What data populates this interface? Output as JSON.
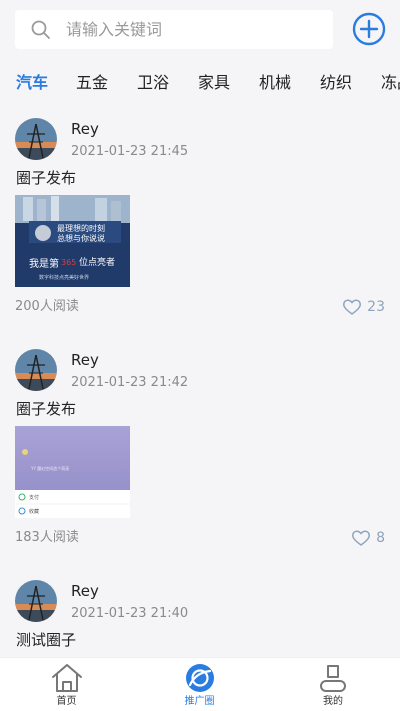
{
  "search": {
    "placeholder": "请输入关键词",
    "icon": "search-icon"
  },
  "header": {
    "add_icon": "plus-circle-icon"
  },
  "tabs": [
    {
      "label": "汽车",
      "active": true
    },
    {
      "label": "五金"
    },
    {
      "label": "卫浴"
    },
    {
      "label": "家具"
    },
    {
      "label": "机械"
    },
    {
      "label": "纺织"
    },
    {
      "label": "冻品"
    }
  ],
  "posts": [
    {
      "user": "Rey",
      "time": "2021-01-23 21:45",
      "title": "圈子发布",
      "image_text_1": "最理想的时刻",
      "image_text_2": "总想与你说说",
      "image_text_3": "我是第",
      "image_text_4": "365",
      "image_text_5": "位点亮者",
      "image_text_6": "数字科技点亮美好世界",
      "reads": "200人阅读",
      "likes": "23"
    },
    {
      "user": "Rey",
      "time": "2021-01-23 21:42",
      "title": "圈子发布",
      "image_text_1": "YY 魔幻空间造个萌宠",
      "image_text_2": "支付",
      "image_text_3": "收藏",
      "reads": "183人阅读",
      "likes": "8"
    },
    {
      "user": "Rey",
      "time": "2021-01-23 21:40",
      "title": "测试圈子"
    }
  ],
  "tabbar": [
    {
      "label": "首页",
      "icon": "home-icon"
    },
    {
      "label": "推广圈",
      "icon": "promo-circle-icon",
      "active": true
    },
    {
      "label": "我的",
      "icon": "profile-icon"
    }
  ],
  "colors": {
    "accent": "#2a7ce0",
    "like": "#8ea4bd"
  }
}
